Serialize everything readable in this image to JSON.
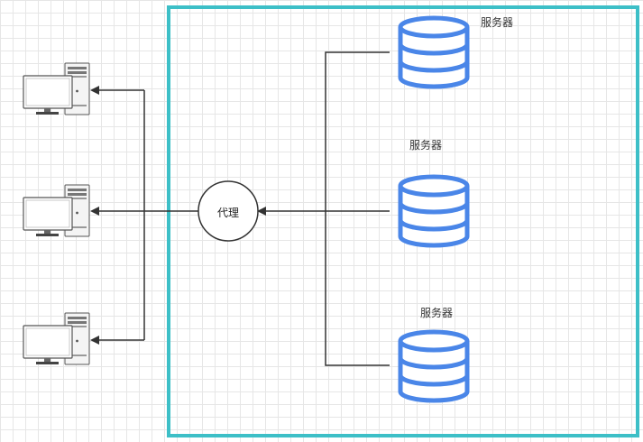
{
  "colors": {
    "boundary": "#3dbfc7",
    "database": "#4a86e8",
    "line": "#333333",
    "grid": "#e6e6e6"
  },
  "servers": [
    {
      "label": "服务器",
      "icon": "database-icon"
    },
    {
      "label": "服务器",
      "icon": "database-icon"
    },
    {
      "label": "服务器",
      "icon": "database-icon"
    }
  ],
  "proxy": {
    "label": "代理"
  },
  "clients": [
    {
      "icon": "desktop-computer-icon"
    },
    {
      "icon": "desktop-computer-icon"
    },
    {
      "icon": "desktop-computer-icon"
    }
  ]
}
